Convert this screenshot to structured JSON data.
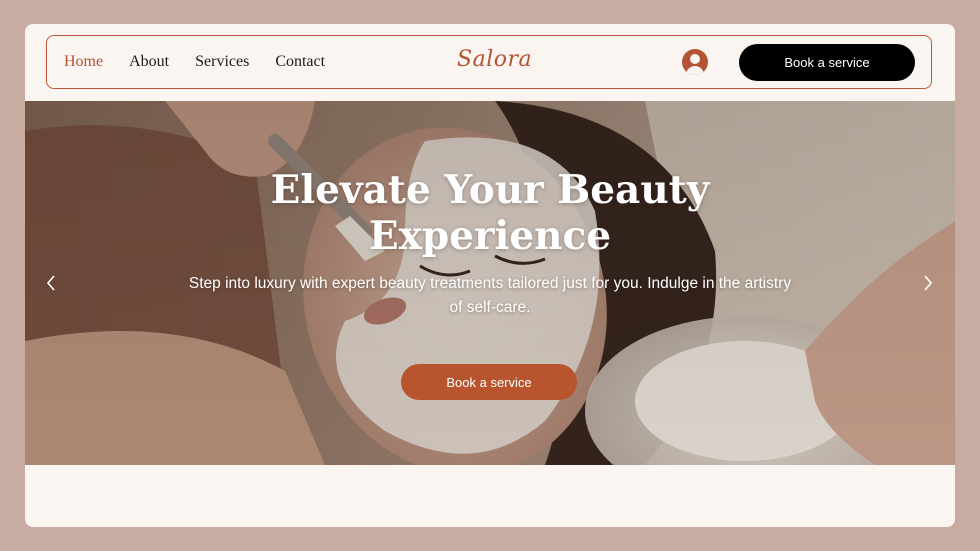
{
  "nav": {
    "links": [
      {
        "label": "Home",
        "active": true
      },
      {
        "label": "About",
        "active": false
      },
      {
        "label": "Services",
        "active": false
      },
      {
        "label": "Contact",
        "active": false
      }
    ],
    "logo": "Salora",
    "cta_label": "Book a service"
  },
  "hero": {
    "title": "Elevate Your Beauty Experience",
    "subtitle": "Step into luxury with expert beauty treatments tailored just for you. Indulge in the artistry of self-care.",
    "cta_label": "Book a service",
    "image": "spa-facial-treatment-photo"
  },
  "icons": {
    "avatar": "user-avatar-icon",
    "prev": "chevron-left-icon",
    "next": "chevron-right-icon"
  },
  "colors": {
    "page_background": "#c9aca1",
    "card_background": "#faf5f1",
    "accent": "#b35434",
    "nav_cta": "#000000",
    "hero_cta": "#b8552f"
  }
}
